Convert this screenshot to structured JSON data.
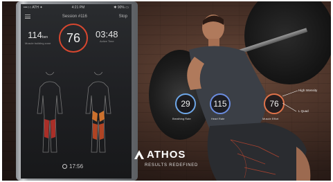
{
  "phone": {
    "status": {
      "carrier": "•••○○ ATH ✦",
      "time": "4:21 PM",
      "battery": "✱ 90% ▭"
    },
    "session": {
      "title": "Session #116",
      "stop": "Stop"
    },
    "score": "76",
    "left_stat": {
      "value": "114",
      "unit": "ben",
      "label": "Muscle building zone"
    },
    "right_stat": {
      "value": "03:48",
      "label": "Active Time"
    },
    "timer": "17:56"
  },
  "metrics": [
    {
      "value": "29",
      "label": "Breathing Rate",
      "color": "#6ea7e8"
    },
    {
      "value": "115",
      "label": "Heart Rate",
      "color": "#6b8de0"
    },
    {
      "value": "76",
      "label": "Muscle Effort",
      "color": "#e0734a"
    }
  ],
  "annotations": {
    "high": "High Intensity",
    "quad": "L Quad"
  },
  "brand": {
    "name": "ATHOS",
    "tagline": "RESULTS REDEFINED"
  },
  "colors": {
    "effort": "#d9472f",
    "accent_blue": "#6ea7e8"
  }
}
